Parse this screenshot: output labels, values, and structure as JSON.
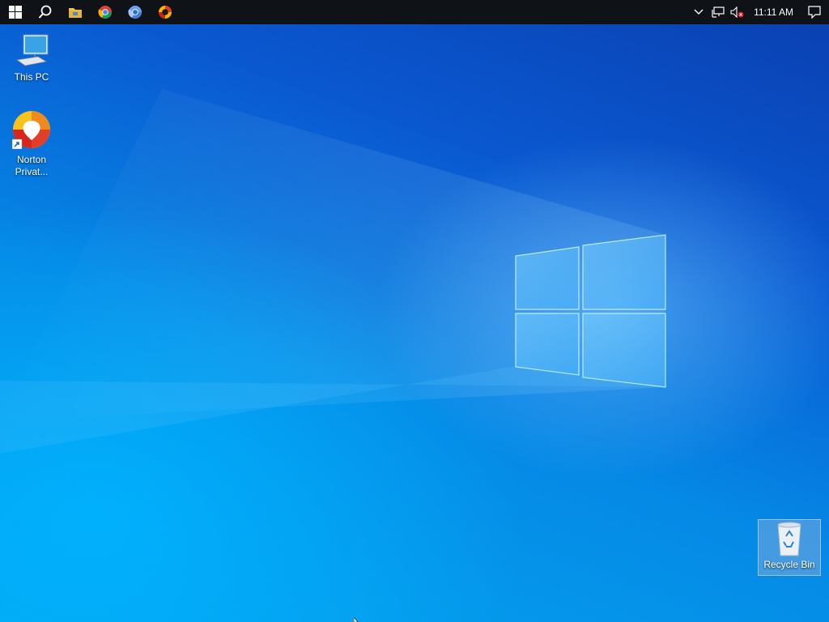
{
  "taskbar": {
    "start_icon": "windows-start-icon",
    "search_icon": "search-icon",
    "pinned": [
      {
        "name": "file-explorer-icon"
      },
      {
        "name": "chrome-icon"
      },
      {
        "name": "chromium-icon"
      },
      {
        "name": "norton-browser-icon"
      }
    ],
    "tray": {
      "chevron": "chevron-up-icon",
      "network": "network-icon",
      "volume": "volume-muted-icon",
      "clock": "11:11 AM",
      "notifications": "action-center-icon"
    },
    "colors": {
      "background": "#0f1318"
    }
  },
  "desktop": {
    "icons": [
      {
        "label": "This PC",
        "icon": "computer-icon"
      },
      {
        "label": "Norton\nPrivat...",
        "label_line1": "Norton",
        "label_line2": "Privat...",
        "icon": "norton-private-browser-icon"
      },
      {
        "label": "Recycle Bin",
        "icon": "recycle-bin-icon"
      }
    ],
    "wallpaper": {
      "accent": "#0a58d0",
      "light": "#04a6f0"
    }
  }
}
